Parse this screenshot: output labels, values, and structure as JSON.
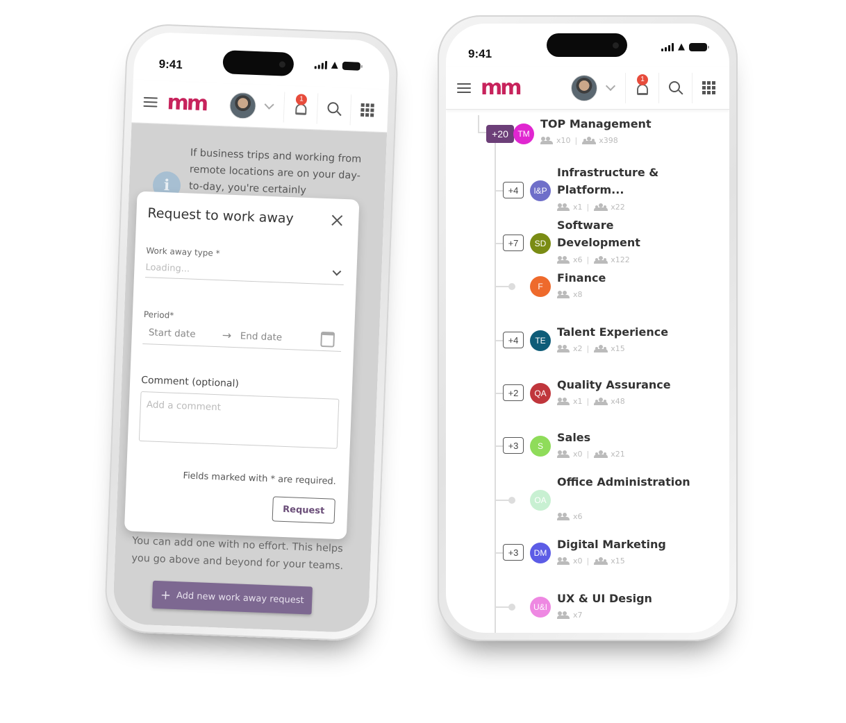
{
  "status_bar": {
    "time": "9:41"
  },
  "header": {
    "logo_text": "m",
    "notification_count": "1",
    "icons": [
      "hamburger-menu-icon",
      "logo-icon",
      "avatar",
      "chevron-down-icon",
      "bell-icon",
      "search-icon",
      "apps-grid-icon"
    ]
  },
  "left_phone": {
    "info_text": "If business trips and working from remote locations are on your day-to-day, you're certainly",
    "info_icon": "i",
    "dialog": {
      "title": "Request to work away",
      "work_away_type_label": "Work away type *",
      "work_away_type_value": "Loading...",
      "period_label": "Period*",
      "start_date_placeholder": "Start date",
      "end_date_placeholder": "End date",
      "arrow": "→",
      "comment_label": "Comment (optional)",
      "comment_placeholder": "Add a comment",
      "required_note": "Fields marked with * are required.",
      "request_button": "Request"
    },
    "bottom_text": "You can add one with no effort. This helps you go above and beyond for your teams.",
    "add_button": {
      "icon": "+",
      "label": "Add new work away request"
    },
    "colors": {
      "brand": "#c7235c",
      "primary_button": "#7d6891"
    }
  },
  "right_phone": {
    "departments": [
      {
        "name": "TOP Management",
        "initials": "TM",
        "color": "#e026d0",
        "children": "+20",
        "direct": "x10",
        "total": "x398",
        "top": true
      },
      {
        "name": "Infrastructure & Platform...",
        "initials": "I&P",
        "color": "#6f6fc9",
        "children": "+4",
        "direct": "x1",
        "total": "x22"
      },
      {
        "name": "Software Development",
        "initials": "SD",
        "color": "#7a8c14",
        "children": "+7",
        "direct": "x6",
        "total": "x122"
      },
      {
        "name": "Finance",
        "initials": "F",
        "color": "#ee6a2c",
        "children": null,
        "direct": "x8",
        "total": null
      },
      {
        "name": "Talent Experience",
        "initials": "TE",
        "color": "#0e5c78",
        "children": "+4",
        "direct": "x2",
        "total": "x15"
      },
      {
        "name": "Quality Assurance",
        "initials": "QA",
        "color": "#c0363c",
        "children": "+2",
        "direct": "x1",
        "total": "x48"
      },
      {
        "name": "Sales",
        "initials": "S",
        "color": "#8fdc5a",
        "children": "+3",
        "direct": "x0",
        "total": "x21"
      },
      {
        "name": "Office Administration",
        "initials": "OA",
        "color": "#c8f0d2",
        "children": null,
        "direct": "x6",
        "total": null
      },
      {
        "name": "Digital Marketing",
        "initials": "DM",
        "color": "#5c5ce6",
        "children": "+3",
        "direct": "x0",
        "total": "x15"
      },
      {
        "name": "UX & UI Design",
        "initials": "U&I",
        "color": "#ee88e2",
        "children": null,
        "direct": "x7",
        "total": null
      }
    ]
  }
}
